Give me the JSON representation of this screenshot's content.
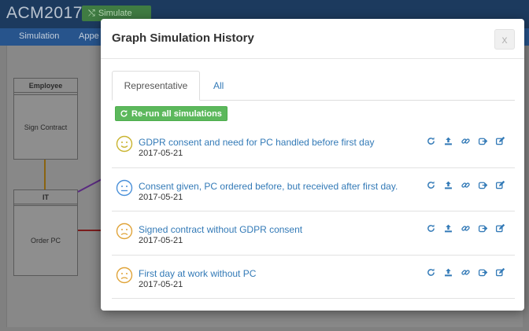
{
  "app": {
    "title": "ACM2017",
    "simulate_label": "Simulate",
    "menu": [
      "Simulation",
      "Appe"
    ]
  },
  "diagram": {
    "lanes": [
      {
        "label": "Employee",
        "task": "Sign Contract"
      },
      {
        "label": "IT",
        "task": "Order PC"
      }
    ]
  },
  "modal": {
    "title": "Graph Simulation History",
    "close_label": "x",
    "tabs": [
      {
        "label": "Representative",
        "active": true
      },
      {
        "label": "All",
        "active": false
      }
    ],
    "rerun_label": "Re-run all simulations",
    "simulations": [
      {
        "title": "GDPR consent and need for PC handled before first day",
        "date": "2017-05-21",
        "mood": "happy",
        "color": "#c9b430"
      },
      {
        "title": "Consent given, PC ordered before, but received after first day.",
        "date": "2017-05-21",
        "mood": "neutral",
        "color": "#4a90d9"
      },
      {
        "title": "Signed contract without GDPR consent",
        "date": "2017-05-21",
        "mood": "sad",
        "color": "#e0a43a"
      },
      {
        "title": "First day at work without PC",
        "date": "2017-05-21",
        "mood": "sad",
        "color": "#e0a43a"
      }
    ],
    "actions": [
      "rerun-icon",
      "upload-icon",
      "link-icon",
      "share-icon",
      "edit-icon"
    ],
    "accent_color": "#337ab7"
  }
}
